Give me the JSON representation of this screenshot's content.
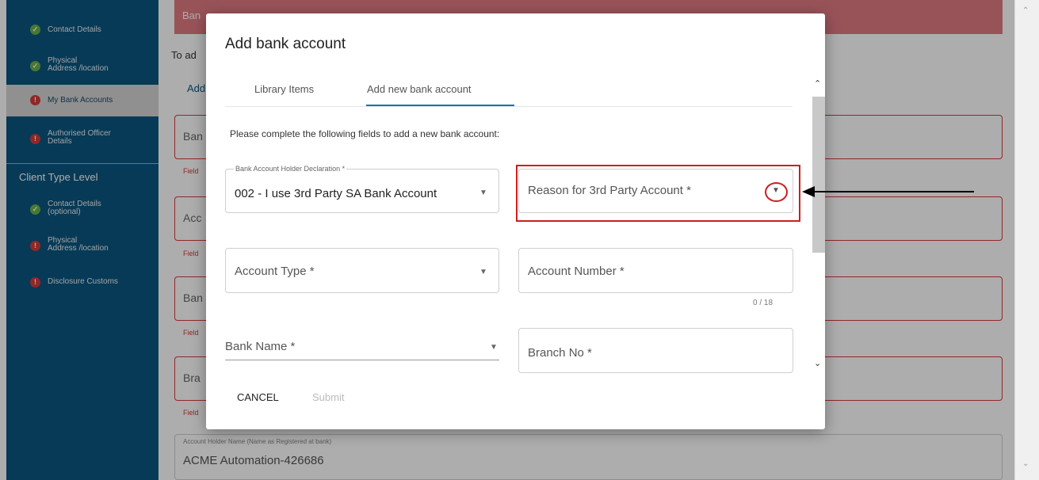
{
  "sidebar": {
    "items": [
      {
        "label": "Contact Details",
        "status": "ok"
      },
      {
        "label": "Physical\nAddress /location",
        "status": "ok"
      },
      {
        "label": "My Bank Accounts",
        "status": "error"
      },
      {
        "label": "Authorised Officer\nDetails",
        "status": "error"
      }
    ],
    "section_title": "Client Type Level",
    "section_items": [
      {
        "label": "Contact Details\n(optional)",
        "status": "ok"
      },
      {
        "label": "Physical\nAddress /location",
        "status": "error"
      },
      {
        "label": "Disclosure Customs",
        "status": "error"
      }
    ]
  },
  "background": {
    "banner_text": "Ban",
    "intro_text": "To ad",
    "add_link": "Add",
    "fields": [
      "Ban",
      "Acc",
      "Ban",
      "Bra"
    ],
    "field_error": "Field",
    "holder_caption": "Account Holder Name (Name as Registered at bank)",
    "holder_value": "ACME Automation-426686"
  },
  "modal": {
    "title": "Add bank account",
    "tabs": [
      {
        "label": "Library Items",
        "active": false
      },
      {
        "label": "Add new bank account",
        "active": true
      }
    ],
    "instruction": "Please complete the following fields to add a new bank account:",
    "holder_declaration": {
      "caption": "Bank Account Holder Declaration *",
      "value": "002 - I use 3rd Party SA Bank Account"
    },
    "reason_placeholder": "Reason for 3rd Party Account *",
    "account_type_placeholder": "Account Type *",
    "account_number_placeholder": "Account Number *",
    "account_number_counter": "0 / 18",
    "bank_name_placeholder": "Bank Name *",
    "branch_no_placeholder": "Branch No *",
    "cancel_label": "CANCEL",
    "submit_label": "Submit"
  },
  "colors": {
    "sidebar_bg": "#0b567f",
    "status_ok": "#6ab04c",
    "status_error": "#d63a3a",
    "tab_active": "#1a73a8",
    "annotation": "#cc1f1f"
  },
  "icons": {
    "check": "check-circle-icon",
    "error": "error-circle-icon",
    "dropdown": "caret-down-icon",
    "arrow": "arrow-left-icon"
  }
}
